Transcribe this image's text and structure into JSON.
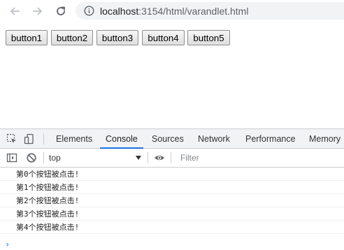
{
  "browser": {
    "url_host": "localhost",
    "url_path": ":3154/html/varandlet.html",
    "icons": [
      "back-arrow-icon",
      "forward-arrow-icon",
      "reload-icon",
      "info-icon"
    ]
  },
  "page": {
    "buttons": [
      {
        "label": "button1"
      },
      {
        "label": "button2"
      },
      {
        "label": "button3"
      },
      {
        "label": "button4"
      },
      {
        "label": "button5"
      }
    ]
  },
  "devtools": {
    "tabs": [
      {
        "label": "Elements"
      },
      {
        "label": "Console"
      },
      {
        "label": "Sources"
      },
      {
        "label": "Network"
      },
      {
        "label": "Performance"
      },
      {
        "label": "Memory"
      }
    ],
    "active_tab": "Console",
    "context": "top",
    "filter_placeholder": "Filter",
    "console_lines": [
      "第0个按钮被点击!",
      "第1个按钮被点击!",
      "第2个按钮被点击!",
      "第3个按钮被点击!",
      "第4个按钮被点击!"
    ],
    "prompt_symbol": "›"
  },
  "colors": {
    "accent": "#1a73e8",
    "tabbar_bg": "#f1f3f4",
    "border": "#cacdd1"
  }
}
